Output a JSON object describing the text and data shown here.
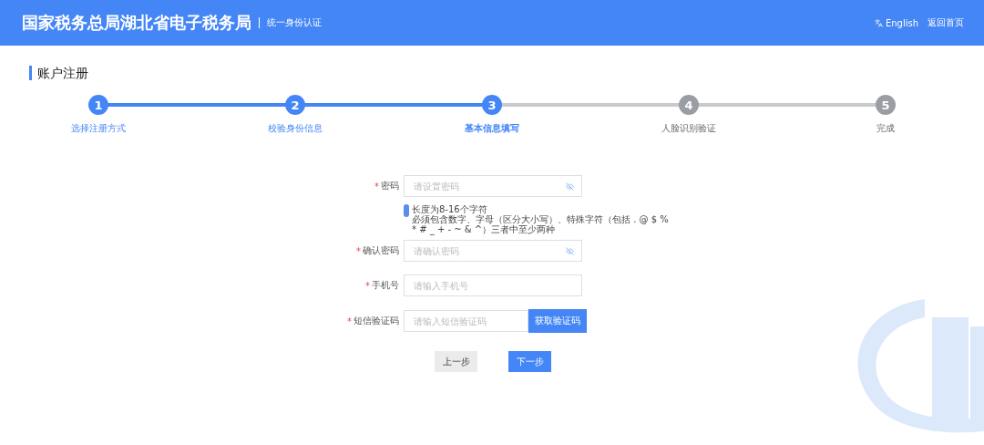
{
  "header": {
    "title": "国家税务总局湖北省电子税务局",
    "subtitle": "统一身份认证",
    "language": "English",
    "home_link": "返回首页"
  },
  "page_title": "账户注册",
  "steps": [
    {
      "number": "1",
      "label": "选择注册方式",
      "selected": false
    },
    {
      "number": "2",
      "label": "校验身份信息",
      "selected": false
    },
    {
      "number": "3",
      "label": "基本信息填写",
      "selected": true
    },
    {
      "number": "4",
      "label": "人脸识别验证",
      "selected": false
    },
    {
      "number": "5",
      "label": "完成",
      "selected": false
    }
  ],
  "fields": [
    {
      "kind": "password",
      "label": "密码",
      "required_mark": "*",
      "placeholder": "请设置密码",
      "hint": [
        "长度为8-16个字符",
        "必须包含数字、字母（区分大小写）、特殊字符（包括 . @ $ %",
        "* # _ + - ~ & ^）三者中至少两种"
      ]
    },
    {
      "kind": "password",
      "label": "确认密码",
      "required_mark": "*",
      "placeholder": "请确认密码"
    },
    {
      "kind": "text",
      "label": "手机号",
      "required_mark": "*",
      "placeholder": "请输入手机号"
    },
    {
      "kind": "sms",
      "label": "短信验证码",
      "required_mark": "*",
      "placeholder": "请输入短信验证码",
      "button": "获取验证码"
    }
  ],
  "buttons": [
    {
      "kind": "secondary",
      "label": "上一步"
    },
    {
      "kind": "primary",
      "label": "下一步"
    }
  ]
}
